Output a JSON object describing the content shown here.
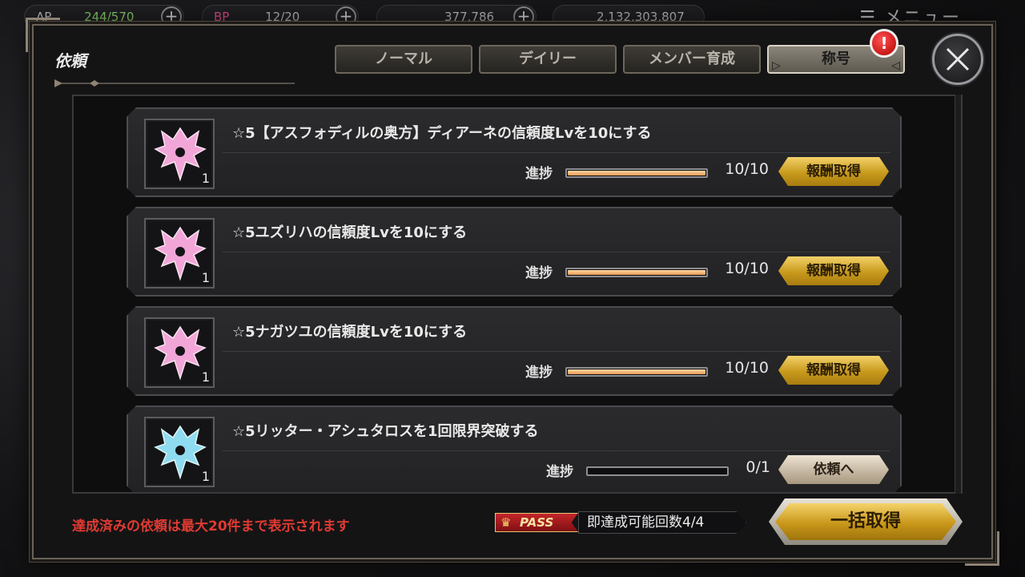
{
  "hud": {
    "ap": "AP",
    "ap_value": "244/570",
    "bp": "BP",
    "bp_value": "12/20",
    "currency1": "377,786",
    "currency2": "2,132,303,807",
    "menu": "メニュー"
  },
  "modal": {
    "title": "依頼",
    "tabs": [
      {
        "label": "ノーマル",
        "active": false
      },
      {
        "label": "デイリー",
        "active": false
      },
      {
        "label": "メンバー育成",
        "active": false
      },
      {
        "label": "称号",
        "active": true
      }
    ],
    "alert_glyph": "!"
  },
  "quests": [
    {
      "title": "☆5【アスフォディルの奥方】ディアーネの信頼度Lvを10にする",
      "count": "1",
      "progress_label": "進捗",
      "progress_text": "10/10",
      "progress": 1.0,
      "button": "報酬取得",
      "badge_color": "pink"
    },
    {
      "title": "☆5ユズリハの信頼度Lvを10にする",
      "count": "1",
      "progress_label": "進捗",
      "progress_text": "10/10",
      "progress": 1.0,
      "button": "報酬取得",
      "badge_color": "pink"
    },
    {
      "title": "☆5ナガツユの信頼度Lvを10にする",
      "count": "1",
      "progress_label": "進捗",
      "progress_text": "10/10",
      "progress": 1.0,
      "button": "報酬取得",
      "badge_color": "pink"
    },
    {
      "title": "☆5リッター・アシュタロスを1回限界突破する",
      "count": "1",
      "progress_label": "進捗",
      "progress_text": "0/1",
      "progress": 0.0,
      "button": "依頼へ",
      "badge_color": "cyan"
    }
  ],
  "footer": {
    "notice": "達成済みの依頼は最大20件まで表示されます",
    "pass_label": "PASS",
    "instant_text": "即達成可能回数4/4",
    "bulk_button": "一括取得"
  },
  "colors": {
    "gold": "#c89a1c",
    "notice_red": "#e03a32",
    "badge_pink": "#f2a6d8",
    "badge_cyan": "#8fdcf0"
  }
}
